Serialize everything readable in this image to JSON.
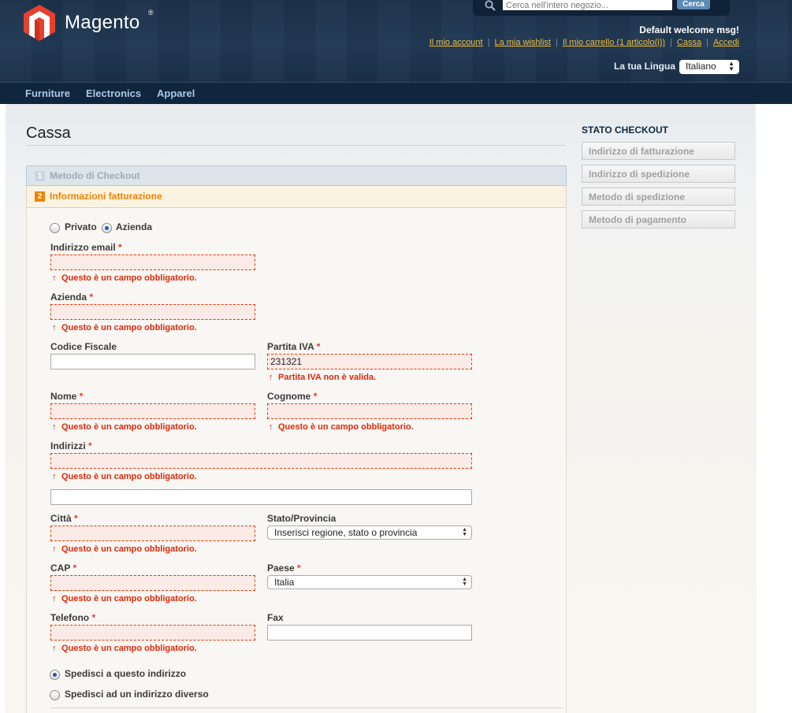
{
  "header": {
    "logo_text": "Magento",
    "logo_reg": "®",
    "search_placeholder": "Cerca nell'intero negozio...",
    "search_button": "Cerca",
    "welcome": "Default welcome msg!",
    "links": [
      "Il mio account",
      "La mia wishlist",
      "Il mio carrello (1 articolo(i))",
      "Cassa",
      "Accedi"
    ],
    "separator": "|",
    "language_label": "La tua Lingua",
    "language_value": "Italiano",
    "colors": {
      "bg": "#1c3249",
      "link": "#ebbb40",
      "logo_red": "#e8402e"
    }
  },
  "nav": {
    "items": [
      "Furniture",
      "Electronics",
      "Apparel"
    ]
  },
  "main": {
    "title": "Cassa",
    "steps": [
      {
        "num": "1",
        "label": "Metodo di Checkout"
      },
      {
        "num": "2",
        "label": "Informazioni fatturazione"
      }
    ],
    "account_type": {
      "options": [
        "Privato",
        "Azienda"
      ],
      "selected": "Azienda"
    },
    "required_mark": "*",
    "arrow": "↑",
    "error_required": "Questo è un campo obbligatorio.",
    "fields": {
      "email": {
        "label": "Indirizzo email"
      },
      "company": {
        "label": "Azienda"
      },
      "tax_code": {
        "label": "Codice Fiscale"
      },
      "vat": {
        "label": "Partita IVA",
        "value": "231321",
        "error": "Partita IVA non è valida."
      },
      "first_name": {
        "label": "Nome"
      },
      "last_name": {
        "label": "Cognome"
      },
      "address": {
        "label": "Indirizzi"
      },
      "city": {
        "label": "Città"
      },
      "region": {
        "label": "Stato/Provincia",
        "value": "Inserisci regione, stato o provincia"
      },
      "zip": {
        "label": "CAP"
      },
      "country": {
        "label": "Paese",
        "value": "Italia"
      },
      "phone": {
        "label": "Telefono"
      },
      "fax": {
        "label": "Fax"
      }
    },
    "shipping_options": {
      "same": "Spedisci a questo indirizzo",
      "different": "Spedisci ad un indirizzo diverso",
      "selected": "same"
    },
    "colors": {
      "error": "#df280a",
      "active_step": "#f18200"
    }
  },
  "sidebar": {
    "title": "STATO CHECKOUT",
    "items": [
      "Indirizzo di fatturazione",
      "Indirizzo di spedizione",
      "Metodo di spedizione",
      "Metodo di pagamento"
    ]
  }
}
